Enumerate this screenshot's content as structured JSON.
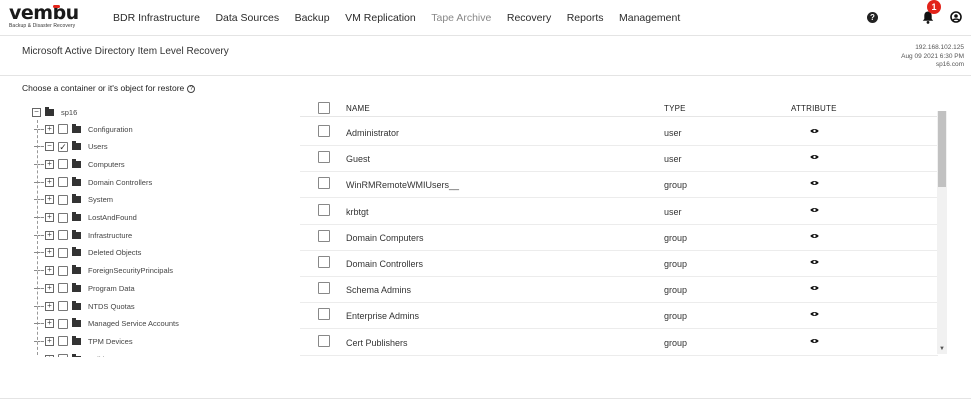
{
  "app": {
    "logo_word": "vembu",
    "logo_tagline": "Backup & Disaster Recovery"
  },
  "nav": {
    "items": [
      {
        "label": "BDR Infrastructure"
      },
      {
        "label": "Data Sources"
      },
      {
        "label": "Backup"
      },
      {
        "label": "VM Replication"
      },
      {
        "label": "Tape Archive"
      },
      {
        "label": "Recovery"
      },
      {
        "label": "Reports"
      },
      {
        "label": "Management"
      }
    ],
    "help_glyph": "?",
    "notification_count": "1",
    "icons": [
      "help-icon",
      "bell-icon",
      "user-icon"
    ]
  },
  "header": {
    "title": "Microsoft Active Directory Item Level Recovery",
    "server_ip": "192.168.102.125",
    "server_time": "Aug 09 2021 6:30 PM",
    "server_name": "sp16.com"
  },
  "tree": {
    "label": "Choose a container or it's object for restore",
    "root": "sp16",
    "nodes": [
      {
        "label": "Configuration",
        "checked": false
      },
      {
        "label": "Users",
        "checked": true
      },
      {
        "label": "Computers",
        "checked": false
      },
      {
        "label": "Domain Controllers",
        "checked": false
      },
      {
        "label": "System",
        "checked": false
      },
      {
        "label": "LostAndFound",
        "checked": false
      },
      {
        "label": "Infrastructure",
        "checked": false
      },
      {
        "label": "Deleted Objects",
        "checked": false
      },
      {
        "label": "ForeignSecurityPrincipals",
        "checked": false
      },
      {
        "label": "Program Data",
        "checked": false
      },
      {
        "label": "NTDS Quotas",
        "checked": false
      },
      {
        "label": "Managed Service Accounts",
        "checked": false
      },
      {
        "label": "TPM Devices",
        "checked": false
      },
      {
        "label": "Builtin",
        "checked": false
      }
    ]
  },
  "table": {
    "columns": {
      "name": "NAME",
      "type": "TYPE",
      "attribute": "ATTRIBUTE"
    },
    "rows": [
      {
        "name": "Administrator",
        "type": "user"
      },
      {
        "name": "Guest",
        "type": "user"
      },
      {
        "name": "WinRMRemoteWMIUsers__",
        "type": "group"
      },
      {
        "name": "krbtgt",
        "type": "user"
      },
      {
        "name": "Domain Computers",
        "type": "group"
      },
      {
        "name": "Domain Controllers",
        "type": "group"
      },
      {
        "name": "Schema Admins",
        "type": "group"
      },
      {
        "name": "Enterprise Admins",
        "type": "group"
      },
      {
        "name": "Cert Publishers",
        "type": "group"
      }
    ]
  },
  "colors": {
    "accent_red": "#e2231a",
    "text": "#333333",
    "border": "#e4e4e4"
  }
}
